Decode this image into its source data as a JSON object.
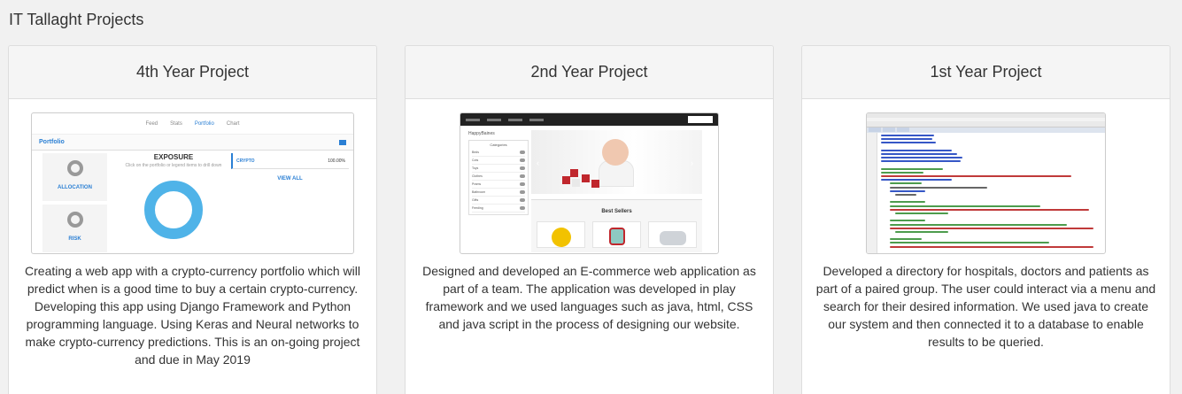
{
  "page": {
    "heading": "IT Tallaght Projects"
  },
  "projects": [
    {
      "title": "4th Year Project",
      "description": "Creating a web app with a crypto-currency portfolio which will predict when is a good time to buy a certain crypto-currency. Developing this app using Django Framework and Python programming language. Using Keras and Neural networks to make crypto-currency predictions. This is an on-going project and due in May 2019",
      "screenshot": {
        "nav": [
          "Feed",
          "Stats",
          "Portfolio",
          "Chart"
        ],
        "portfolio_label": "Portfolio",
        "exposure_title": "EXPOSURE",
        "exposure_hint": "Click on the portfolio or legend items to drill down",
        "allocation_label": "ALLOCATION",
        "risk_label": "RISK",
        "coin_label": "CRYPTO",
        "coin_percent": "100.00%",
        "view_all": "VIEW ALL",
        "donut_color": "#4fb3e8",
        "accent_color": "#2a7fd4"
      }
    },
    {
      "title": "2nd Year Project",
      "description": "Designed and developed an E-commerce web application as part of a team. The application was developed in play framework and we used languages such as java, html, CSS and java script in the process of designing our website.",
      "screenshot": {
        "brand": "HappyBaines",
        "categories_caption": "Categories",
        "categories": [
          "Beds",
          "Cots",
          "Toys",
          "Clothes",
          "Prams",
          "Bathroom",
          "Gifts",
          "Feeding"
        ],
        "best_sellers": "Best Sellers",
        "carousel_prev": "‹",
        "carousel_next": "›"
      }
    },
    {
      "title": "1st Year Project",
      "description": "Developed a directory for hospitals, doctors and patients as part of a paired group. The user could interact via a menu and search for their desired information. We used java to create our system and then connected it to a database to enable results to be queried.",
      "screenshot": {
        "type": "code-editor"
      }
    }
  ]
}
